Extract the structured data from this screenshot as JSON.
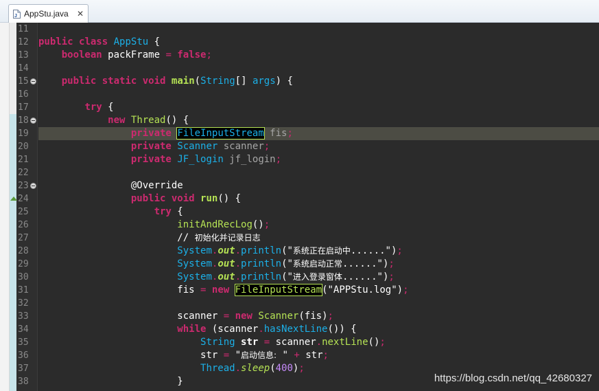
{
  "tab": {
    "filename": "AppStu.java",
    "close_glyph": "✕",
    "icon": "java-file-icon"
  },
  "watermark": "https://blog.csdn.net/qq_42680327",
  "lines": [
    {
      "n": "11"
    },
    {
      "n": "12",
      "t": [
        "public",
        " ",
        "class",
        " ",
        "AppStu",
        " {"
      ]
    },
    {
      "n": "13",
      "t": [
        "boolean",
        " packFrame ",
        "=",
        " ",
        "false",
        ";"
      ]
    },
    {
      "n": "14"
    },
    {
      "n": "15",
      "t": [
        "public",
        " ",
        "static",
        " ",
        "void",
        " ",
        "main",
        "(",
        "String",
        "[] ",
        "args",
        ") {"
      ]
    },
    {
      "n": "16"
    },
    {
      "n": "17",
      "t": [
        "try",
        " {"
      ]
    },
    {
      "n": "18",
      "t": [
        "new",
        " ",
        "Thread",
        "() {"
      ]
    },
    {
      "n": "19",
      "t": [
        "private",
        " ",
        "FileInputStream",
        " fis",
        ";"
      ]
    },
    {
      "n": "20",
      "t": [
        "private",
        " ",
        "Scanner",
        " scanner",
        ";"
      ]
    },
    {
      "n": "21",
      "t": [
        "private",
        " ",
        "JF_login",
        " jf_login",
        ";"
      ]
    },
    {
      "n": "22"
    },
    {
      "n": "23",
      "t": [
        "@Override"
      ]
    },
    {
      "n": "24",
      "t": [
        "public",
        " ",
        "void",
        " ",
        "run",
        "() {"
      ]
    },
    {
      "n": "25",
      "t": [
        "try",
        " {"
      ]
    },
    {
      "n": "26",
      "t": [
        "initAndRecLog",
        "()",
        ";"
      ]
    },
    {
      "n": "27",
      "t": [
        "// ",
        "初始化并记录日志"
      ]
    },
    {
      "n": "28",
      "t": [
        "System",
        ".",
        "out",
        ".",
        "println",
        "(\"",
        "系统正在启动中",
        "......\")",
        ";"
      ]
    },
    {
      "n": "29",
      "t": [
        "System",
        ".",
        "out",
        ".",
        "println",
        "(\"",
        "系统启动正常",
        "......\")",
        ";"
      ]
    },
    {
      "n": "30",
      "t": [
        "System",
        ".",
        "out",
        ".",
        "println",
        "(\"",
        "进入登录窗体",
        "......\")",
        ";"
      ]
    },
    {
      "n": "31",
      "t": [
        "fis ",
        "=",
        " ",
        "new",
        " ",
        "FileInputStream",
        "(\"APPStu.log\")",
        ";"
      ]
    },
    {
      "n": "32"
    },
    {
      "n": "33",
      "t": [
        "scanner ",
        "=",
        " ",
        "new",
        " ",
        "Scanner",
        "(fis)",
        ";"
      ]
    },
    {
      "n": "34",
      "t": [
        "while",
        " (scanner",
        ".",
        "hasNextLine",
        "()) {"
      ]
    },
    {
      "n": "35",
      "t": [
        "String",
        " ",
        "str",
        " ",
        "=",
        " scanner",
        ".",
        "nextLine",
        "()",
        ";"
      ]
    },
    {
      "n": "36",
      "t": [
        "str ",
        "=",
        " \"",
        "启动信息:",
        " \" ",
        "+",
        " str",
        ";"
      ]
    },
    {
      "n": "37",
      "t": [
        "Thread",
        ".",
        "sleep",
        "(",
        "400",
        ")",
        ";"
      ]
    },
    {
      "n": "38",
      "t": [
        "}"
      ]
    }
  ]
}
